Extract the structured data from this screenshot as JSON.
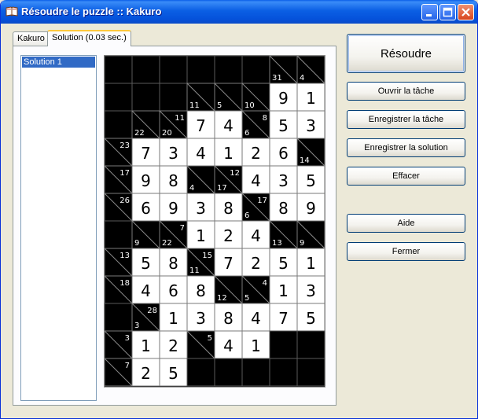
{
  "window": {
    "title": "Résoudre le puzzle :: Kakuro",
    "colors": {
      "titlebar": "#0b5fe4",
      "selection": "#316ac5",
      "button_border": "#003c74"
    }
  },
  "tabs": [
    {
      "label": "Kakuro",
      "active": false
    },
    {
      "label": "Solution (0.03 sec.)",
      "active": true
    }
  ],
  "solutions": [
    {
      "label": "Solution 1",
      "selected": true
    }
  ],
  "buttons": {
    "resoudre": "Résoudre",
    "ouvrir": "Ouvrir la tâche",
    "enregistrer_tache": "Enregistrer la tâche",
    "enregistrer_solution": "Enregistrer la solution",
    "effacer": "Effacer",
    "aide": "Aide",
    "fermer": "Fermer"
  },
  "grid": {
    "rows": [
      [
        "#",
        "#",
        "#",
        "#",
        "#",
        "#",
        "c:31/",
        "c:4/"
      ],
      [
        "#",
        "#",
        "#",
        "c:11/",
        "c:5/",
        "c:10/",
        9,
        1
      ],
      [
        "#",
        "c:22/",
        "c:20/11",
        7,
        4,
        "c:6/8",
        5,
        3
      ],
      [
        "c:/23",
        7,
        3,
        4,
        1,
        2,
        6,
        "c:14/"
      ],
      [
        "c:/17",
        9,
        8,
        "c:4/",
        "c:17/12",
        4,
        3,
        5
      ],
      [
        "c:/26",
        6,
        9,
        3,
        8,
        "c:6/17",
        8,
        9
      ],
      [
        "#",
        "c:9/",
        "c:22/7",
        1,
        2,
        4,
        "c:13/",
        "c:9/"
      ],
      [
        "c:/13",
        5,
        8,
        "c:11/15",
        7,
        2,
        5,
        1
      ],
      [
        "c:/18",
        4,
        6,
        8,
        "c:12/",
        "c:5/4",
        1,
        3
      ],
      [
        "#",
        "c:3/28",
        1,
        3,
        8,
        4,
        7,
        5
      ],
      [
        "c:/3",
        1,
        2,
        "c:/5",
        4,
        1,
        "#",
        "#"
      ],
      [
        "c:/7",
        2,
        5,
        "#",
        "#",
        "#",
        "#",
        "#"
      ]
    ]
  }
}
